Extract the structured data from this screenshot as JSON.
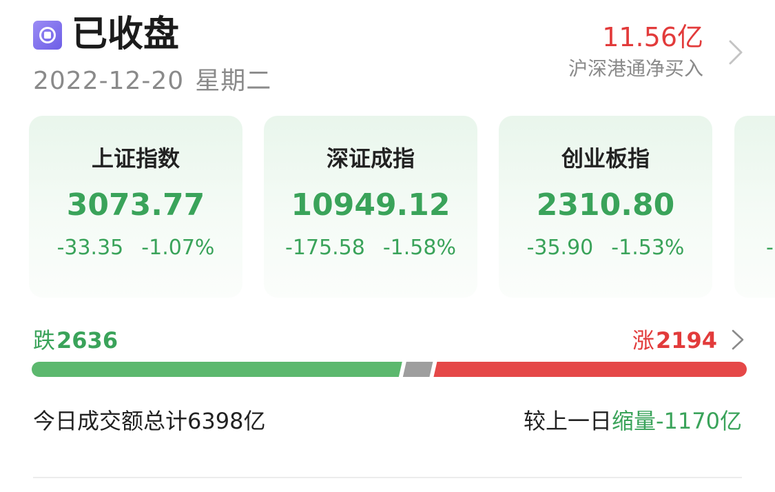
{
  "header": {
    "status_icon": "stop-square-icon",
    "status": "已收盘",
    "date": "2022-12-20",
    "weekday": "星期二",
    "northbound": {
      "value": "11.56亿",
      "label": "沪深港通净买入",
      "chevron_icon": "chevron-right-icon"
    }
  },
  "indices": [
    {
      "name": "上证指数",
      "price": "3073.77",
      "change": "-33.35",
      "pct": "-1.07%"
    },
    {
      "name": "深证成指",
      "price": "10949.12",
      "change": "-175.58",
      "pct": "-1.58%"
    },
    {
      "name": "创业板指",
      "price": "2310.80",
      "change": "-35.90",
      "pct": "-1.53%"
    },
    {
      "name": "",
      "price": "",
      "change": "-",
      "pct": ""
    }
  ],
  "breadth": {
    "fall_label": "跌",
    "fall_count": "2636",
    "rise_label": "涨",
    "rise_count": "2194",
    "chevron_icon": "chevron-right-icon",
    "fall_share": 0.521,
    "flat_share": 0.043,
    "rise_share": 0.436
  },
  "turnover": {
    "total_text": "今日成交额总计6398亿",
    "compare_prefix": "较上一日",
    "compare_word": "缩量",
    "compare_value": "-1170亿"
  },
  "colors": {
    "up": "#e23b3b",
    "down": "#3aa35a",
    "flat": "#9e9e9e",
    "icon": "#7b6cf0"
  }
}
